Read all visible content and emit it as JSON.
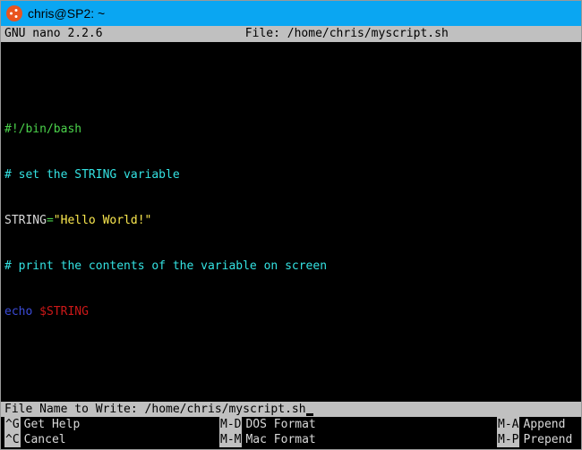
{
  "window": {
    "title": "chris@SP2: ~"
  },
  "nano": {
    "version": "GNU nano 2.2.6",
    "file_label": "File: /home/chris/myscript.sh"
  },
  "script": {
    "l1": "#!/bin/bash",
    "l2": "# set the STRING variable",
    "l3_var": "STRING",
    "l3_eq": "=",
    "l3_val": "\"Hello World!\"",
    "l4": "# print the contents of the variable on screen",
    "l5_cmd": "echo ",
    "l5_var": "$STRING"
  },
  "prompt": {
    "label": "File Name to Write: ",
    "value": "/home/chris/myscript.sh"
  },
  "shortcuts": {
    "r1": {
      "k1": "^G",
      "t1": "Get Help",
      "k2": "M-D",
      "t2": "DOS Format",
      "k3": "M-A",
      "t3": "Append"
    },
    "r2": {
      "k1": "^C",
      "t1": "Cancel",
      "k2": "M-M",
      "t2": "Mac Format",
      "k3": "M-P",
      "t3": "Prepend"
    }
  }
}
